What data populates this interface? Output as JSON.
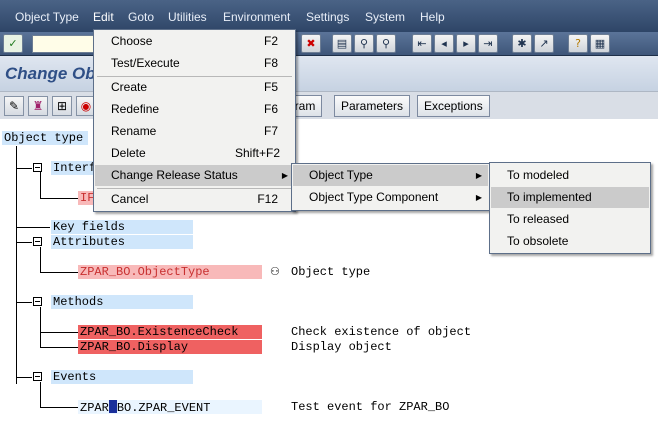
{
  "menubar": {
    "items": [
      "Object Type",
      "Edit",
      "Goto",
      "Utilities",
      "Environment",
      "Settings",
      "System",
      "Help"
    ]
  },
  "toolbar": {
    "icons": [
      "enter-icon",
      "save-icon",
      "back-icon",
      "exit-icon",
      "cancel-icon",
      "print-icon",
      "find-icon",
      "find-next-icon",
      "first-page-icon",
      "prev-page-icon",
      "next-page-icon",
      "last-page-icon",
      "create-session-icon",
      "shortcut-icon",
      "help-icon",
      "customize-layout-icon"
    ]
  },
  "title": "Change Ob",
  "app_toolbar": {
    "buttons": [
      "gram",
      "Parameters",
      "Exceptions"
    ]
  },
  "tree": {
    "root": "Object type",
    "interfaces_label": "Interf",
    "interface_item": "IF",
    "key_fields": "Key fields",
    "attributes": "Attributes",
    "attribute_item": "ZPAR_BO.ObjectType",
    "attribute_desc": "Object type",
    "methods": "Methods",
    "method_items": [
      {
        "name": "ZPAR_BO.ExistenceCheck",
        "desc": "Check existence of object"
      },
      {
        "name": "ZPAR_BO.Display",
        "desc": "Display object"
      }
    ],
    "events": "Events",
    "event_item_prefix": "ZPAR",
    "event_item_suffix": "BO.ZPAR_EVENT",
    "event_desc": "Test event for ZPAR_BO"
  },
  "edit_menu": {
    "items": [
      {
        "label": "Choose",
        "shortcut": "F2"
      },
      {
        "label": "Test/Execute",
        "shortcut": "F8"
      },
      {
        "label": "Create",
        "shortcut": "F5"
      },
      {
        "label": "Redefine",
        "shortcut": "F6"
      },
      {
        "label": "Rename",
        "shortcut": "F7"
      },
      {
        "label": "Delete",
        "shortcut": "Shift+F2"
      },
      {
        "label": "Change Release Status",
        "shortcut": ""
      },
      {
        "label": "Cancel",
        "shortcut": "F12"
      }
    ]
  },
  "release_submenu": {
    "items": [
      "Object Type",
      "Object Type Component"
    ]
  },
  "status_submenu": {
    "items": [
      "To modeled",
      "To implemented",
      "To released",
      "To obsolete"
    ]
  }
}
